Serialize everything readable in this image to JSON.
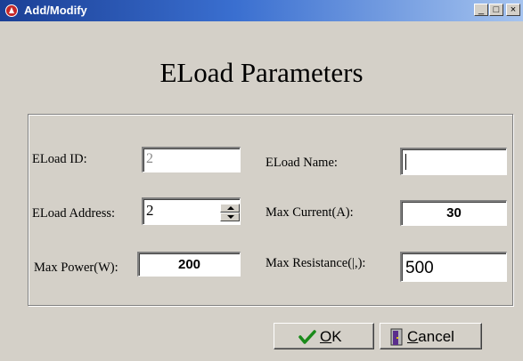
{
  "window": {
    "title": "Add/Modify",
    "minimize_glyph": "_",
    "maximize_glyph": "□",
    "close_glyph": "×",
    "accent_color": "#1b3f95"
  },
  "heading": "ELoad Parameters",
  "form": {
    "eload_id": {
      "label": "ELoad ID:",
      "value": "2"
    },
    "eload_name": {
      "label": "ELoad Name:",
      "value": ""
    },
    "eload_address": {
      "label": "ELoad Address:",
      "value": "2"
    },
    "max_current": {
      "label": "Max Current(A):",
      "value": "30"
    },
    "max_power": {
      "label": "Max Power(W):",
      "value": "200"
    },
    "max_resistance": {
      "label": "Max Resistance(|,):",
      "value": "500"
    }
  },
  "buttons": {
    "ok_mnemonic": "O",
    "ok_rest": "K",
    "cancel_mnemonic": "C",
    "cancel_rest": "ancel",
    "ok_icon": "check-icon",
    "cancel_icon": "door-icon"
  }
}
